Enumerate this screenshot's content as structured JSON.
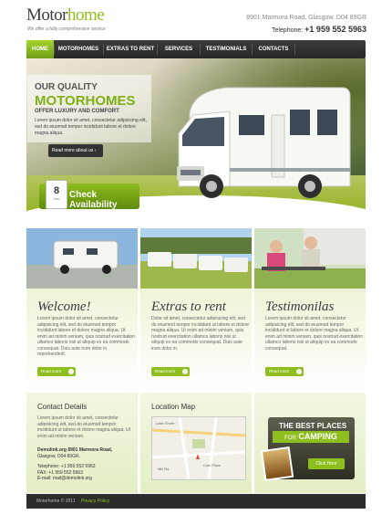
{
  "header": {
    "logo_part1": "Motor",
    "logo_part2": "home",
    "tagline": "We offer a fully comprehensive service",
    "address": "8901 Marmora Road, Glasgow,  D04 89GR",
    "phone_label": "Telephone:",
    "phone": "+1 959 552 5963"
  },
  "nav": {
    "items": [
      {
        "label": "HOME",
        "active": true
      },
      {
        "label": "MOTORHOMES",
        "active": false
      },
      {
        "label": "EXTRAS TO RENT",
        "active": false
      },
      {
        "label": "SERVICES",
        "active": false
      },
      {
        "label": "TESTIMONIALS",
        "active": false
      },
      {
        "label": "CONTACTS",
        "active": false
      }
    ]
  },
  "hero": {
    "line1": "OUR QUALITY",
    "line2": "MOTORHOMES",
    "line3": "OFFER LUXURY AND COMFORT",
    "text": "Lorem ipsum dolor sit amet, consectetur adipisicing elit, sed do eiusmod tempor incididunt labore et dolore magna aliqua.",
    "read_more": "Read more about us",
    "calendar_day": "8",
    "calendar_month": "Mar",
    "check_label": "Check Availability"
  },
  "columns": [
    {
      "title": "Welcome!",
      "text": "Lorem ipsum dolor sit amet, consectetur adipisicing elit, sed do eiusmod tempor incididunt labore et dolore magna aliqua. Ut enim ad minim veniam, quis nostrud exercitation ullamco laboris nisi ut aliquip ex ea commodo consequat. Duis aute irure dolor in reprehenderit.",
      "button": "Read more"
    },
    {
      "title": "Extras to rent",
      "text": "Dolor sit amet, consectetur adipisicing elit, sed do eiusmod tempor incididunt ut labore et dolore magna aliqua. Ut enim ad minim veniam, quis nostrud exercitation ullamco laboris nisi ut aliquip ex ea commodo consequat. Duis aute irure dolor in.",
      "button": "Read more"
    },
    {
      "title": "Testimonilas",
      "text": "Lorem ipsum dolor sit amet, consectetur adipisicing elit, sed do eiusmod tempor incididunt ut labore et dolore magna aliqua. Ut enim ad minim veniam, quis nostrud exercitation ullamco laboris nisi ut aliquip ex ea commodo consequat.",
      "button": "Read more"
    }
  ],
  "contact": {
    "title": "Contact Details",
    "text": "Lorem ipsum dolor sit amet, consectetur adipisicing elit, sed do eiusmod tempor incididunt ut labore et dolore magna aliqua. Ut enim ad minim veniam.",
    "address_label": "Demolink.org",
    "address": "8901 Marmora Road,",
    "city": "Glasgow, D04 89GR.",
    "tel": "Telephone: +1 959 552 5963",
    "fax": "FAX: +1 959 552 5963",
    "email": "E-mail: mail@demolink.org"
  },
  "map": {
    "title": "Location Map",
    "label1": "Lake Shore",
    "label2": "Cole Place",
    "label3": "Mill Rd"
  },
  "promo": {
    "line1": "THE BEST PLACES",
    "line2_small": "FOR",
    "line2": "CAMPING",
    "button": "Click Here"
  },
  "footer": {
    "copyright": "Motorhome © 2011",
    "privacy": "Privacy Policy"
  },
  "colors": {
    "accent": "#8ebf1e",
    "dark": "#2c2c2c"
  }
}
